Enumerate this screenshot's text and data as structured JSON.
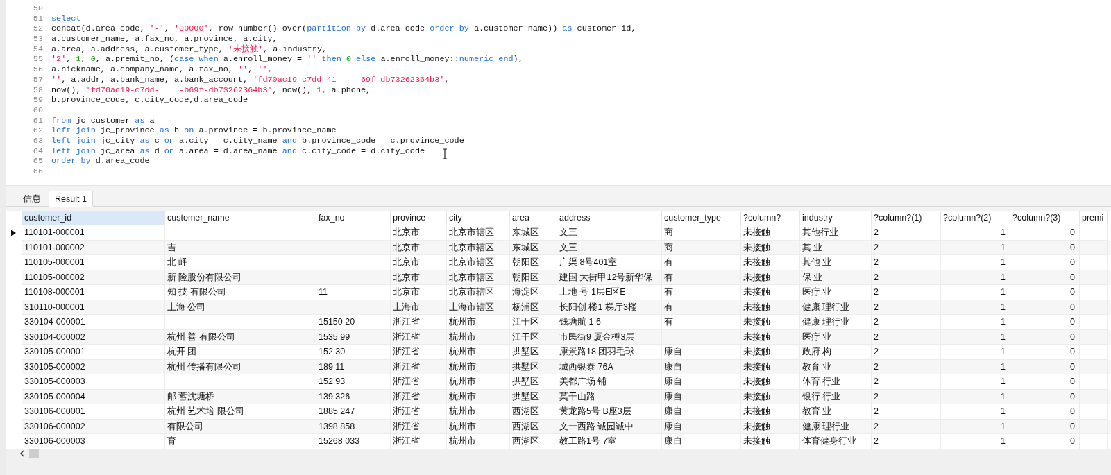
{
  "editor": {
    "lines": [
      {
        "number": "50"
      },
      {
        "number": "51",
        "tokens": [
          {
            "kind": "kw",
            "text": "select"
          }
        ]
      },
      {
        "number": "52",
        "tokens": [
          {
            "kind": "plain",
            "text": "concat(d.area_code, "
          },
          {
            "kind": "str",
            "text": "'-'"
          },
          {
            "kind": "plain",
            "text": ", "
          },
          {
            "kind": "str",
            "text": "'00000'"
          },
          {
            "kind": "plain",
            "text": ", row_number() over("
          },
          {
            "kind": "kw",
            "text": "partition by"
          },
          {
            "kind": "plain",
            "text": " d.area_code "
          },
          {
            "kind": "kw",
            "text": "order by"
          },
          {
            "kind": "plain",
            "text": " a.customer_name)) "
          },
          {
            "kind": "kw",
            "text": "as"
          },
          {
            "kind": "plain",
            "text": " customer_id,"
          }
        ]
      },
      {
        "number": "53",
        "tokens": [
          {
            "kind": "plain",
            "text": "a.customer_name, a.fax_no, a.province, a.city,"
          }
        ]
      },
      {
        "number": "54",
        "tokens": [
          {
            "kind": "plain",
            "text": "a.area, a.address, a.customer_type, "
          },
          {
            "kind": "str",
            "text": "'未接触'"
          },
          {
            "kind": "plain",
            "text": ", a.industry,"
          }
        ]
      },
      {
        "number": "55",
        "tokens": [
          {
            "kind": "str",
            "text": "'2'"
          },
          {
            "kind": "plain",
            "text": ", "
          },
          {
            "kind": "num",
            "text": "1"
          },
          {
            "kind": "plain",
            "text": ", "
          },
          {
            "kind": "num",
            "text": "0"
          },
          {
            "kind": "plain",
            "text": ", a.premit_no, ("
          },
          {
            "kind": "kw",
            "text": "case when"
          },
          {
            "kind": "plain",
            "text": " a.enroll_money = "
          },
          {
            "kind": "str",
            "text": "''"
          },
          {
            "kind": "kw",
            "text": " then "
          },
          {
            "kind": "num",
            "text": "0"
          },
          {
            "kind": "kw",
            "text": " else"
          },
          {
            "kind": "plain",
            "text": " a.enroll_money::"
          },
          {
            "kind": "kw",
            "text": "numeric end"
          },
          {
            "kind": "plain",
            "text": "),"
          }
        ]
      },
      {
        "number": "56",
        "tokens": [
          {
            "kind": "plain",
            "text": "a.nickname, a.company_name, a.tax_no, "
          },
          {
            "kind": "str",
            "text": "''"
          },
          {
            "kind": "plain",
            "text": ", "
          },
          {
            "kind": "str",
            "text": "''"
          },
          {
            "kind": "plain",
            "text": ","
          }
        ]
      },
      {
        "number": "57",
        "tokens": [
          {
            "kind": "str",
            "text": "''"
          },
          {
            "kind": "plain",
            "text": ", a.addr, a.bank_name, a.bank_account, "
          },
          {
            "kind": "str",
            "text": "'fd70ac19-c7dd-41     69f-db73262364b3'"
          },
          {
            "kind": "plain",
            "text": ","
          }
        ]
      },
      {
        "number": "58",
        "tokens": [
          {
            "kind": "plain",
            "text": "now(), "
          },
          {
            "kind": "str",
            "text": "'fd70ac19-c7dd-    -b69f-db73262364b3'"
          },
          {
            "kind": "plain",
            "text": ", now(), "
          },
          {
            "kind": "num",
            "text": "1"
          },
          {
            "kind": "plain",
            "text": ", a.phone,"
          }
        ]
      },
      {
        "number": "59",
        "tokens": [
          {
            "kind": "plain",
            "text": "b.province_code, c.city_code,d.area_code"
          }
        ]
      },
      {
        "number": "60"
      },
      {
        "number": "61",
        "tokens": [
          {
            "kind": "kw",
            "text": "from"
          },
          {
            "kind": "plain",
            "text": " jc_customer "
          },
          {
            "kind": "kw",
            "text": "as"
          },
          {
            "kind": "plain",
            "text": " a"
          }
        ]
      },
      {
        "number": "62",
        "tokens": [
          {
            "kind": "kw",
            "text": "left join"
          },
          {
            "kind": "plain",
            "text": " jc_province "
          },
          {
            "kind": "kw",
            "text": "as"
          },
          {
            "kind": "plain",
            "text": " b "
          },
          {
            "kind": "kw",
            "text": "on"
          },
          {
            "kind": "plain",
            "text": " a.province = b.province_name"
          }
        ]
      },
      {
        "number": "63",
        "tokens": [
          {
            "kind": "kw",
            "text": "left join"
          },
          {
            "kind": "plain",
            "text": " jc_city "
          },
          {
            "kind": "kw",
            "text": "as"
          },
          {
            "kind": "plain",
            "text": " c "
          },
          {
            "kind": "kw",
            "text": "on"
          },
          {
            "kind": "plain",
            "text": " a.city = c.city_name "
          },
          {
            "kind": "kw",
            "text": "and"
          },
          {
            "kind": "plain",
            "text": " b.province_code = c.province_code"
          }
        ]
      },
      {
        "number": "64",
        "tokens": [
          {
            "kind": "kw",
            "text": "left join"
          },
          {
            "kind": "plain",
            "text": " jc_area "
          },
          {
            "kind": "kw",
            "text": "as"
          },
          {
            "kind": "plain",
            "text": " d "
          },
          {
            "kind": "kw",
            "text": "on"
          },
          {
            "kind": "plain",
            "text": " a.area = d.area_name "
          },
          {
            "kind": "kw",
            "text": "and"
          },
          {
            "kind": "plain",
            "text": " c.city_code = d.city_code"
          }
        ]
      },
      {
        "number": "65",
        "tokens": [
          {
            "kind": "kw",
            "text": "order by"
          },
          {
            "kind": "plain",
            "text": " d.area_code"
          }
        ]
      },
      {
        "number": "66"
      }
    ]
  },
  "tabs": [
    {
      "label": "信息",
      "selected": false
    },
    {
      "label": "Result 1",
      "selected": true
    }
  ],
  "table": {
    "columns": [
      {
        "label": "customer_id",
        "selected": true
      },
      {
        "label": "customer_name",
        "selected": false
      },
      {
        "label": "fax_no",
        "selected": false
      },
      {
        "label": "province",
        "selected": false
      },
      {
        "label": "city",
        "selected": false
      },
      {
        "label": "area",
        "selected": false
      },
      {
        "label": "address",
        "selected": false
      },
      {
        "label": "customer_type",
        "selected": false
      },
      {
        "label": "?column?",
        "selected": false
      },
      {
        "label": "industry",
        "selected": false
      },
      {
        "label": "?column?(1)",
        "selected": false
      },
      {
        "label": "?column?(2)",
        "selected": false
      },
      {
        "label": "?column?(3)",
        "selected": false
      },
      {
        "label": "premi",
        "selected": false
      }
    ],
    "rows": [
      {
        "current": true,
        "cells": [
          "110101-000001",
          "",
          "",
          "北京市",
          "北京市辖区",
          "东城区",
          "文三",
          "商",
          "未接触",
          "其他行业",
          "2",
          "1",
          "0",
          ""
        ]
      },
      {
        "current": false,
        "cells": [
          "110101-000002",
          "吉",
          "",
          "北京市",
          "北京市辖区",
          "东城区",
          "文三",
          "商",
          "未接触",
          "其 业",
          "2",
          "1",
          "0",
          ""
        ]
      },
      {
        "current": false,
        "cells": [
          "110105-000001",
          "北 峄",
          "",
          "北京市",
          "北京市辖区",
          "朝阳区",
          "广渠 8号401室",
          "有",
          "未接触",
          "其他 业",
          "2",
          "1",
          "0",
          ""
        ]
      },
      {
        "current": false,
        "cells": [
          "110105-000002",
          "新 险股份有限公司",
          "",
          "北京市",
          "北京市辖区",
          "朝阳区",
          "建国 大街甲12号新华保",
          "有",
          "未接触",
          "保 业",
          "2",
          "1",
          "0",
          ""
        ]
      },
      {
        "current": false,
        "cells": [
          "110108-000001",
          "知 技 有限公司",
          "11",
          "北京市",
          "北京市辖区",
          "海淀区",
          "上地 号 1层E区E",
          "有",
          "未接触",
          "医疗 业",
          "2",
          "1",
          "0",
          ""
        ]
      },
      {
        "current": false,
        "cells": [
          "310110-000001",
          "上海 公司",
          "",
          "上海市",
          "上海市辖区",
          "杨浦区",
          "长阳创 楼1 梯厅3楼",
          "有",
          "未接触",
          "健康 理行业",
          "2",
          "1",
          "0",
          ""
        ]
      },
      {
        "current": false,
        "cells": [
          "330104-000001",
          "",
          "15150 20",
          "浙江省",
          "杭州市",
          "江干区",
          "钱塘航 1 6",
          "有",
          "未接触",
          "健康 理行业",
          "2",
          "1",
          "0",
          ""
        ]
      },
      {
        "current": false,
        "cells": [
          "330104-000002",
          "杭州 善 有限公司",
          "1535 99",
          "浙江省",
          "杭州市",
          "江干区",
          "市民街9 厦金樽3层",
          "",
          "未接触",
          "医疗 业",
          "2",
          "1",
          "0",
          ""
        ]
      },
      {
        "current": false,
        "cells": [
          "330105-000001",
          "杭开 团",
          "152 30",
          "浙江省",
          "杭州市",
          "拱墅区",
          "康景路18 团羽毛球",
          "康自",
          "未接触",
          "政府 构",
          "2",
          "1",
          "0",
          ""
        ]
      },
      {
        "current": false,
        "cells": [
          "330105-000002",
          "杭州 传播有限公司",
          "189 11",
          "浙江省",
          "杭州市",
          "拱墅区",
          "城西银泰 76A",
          "康自",
          "未接触",
          "教育 业",
          "2",
          "1",
          "0",
          ""
        ]
      },
      {
        "current": false,
        "cells": [
          "330105-000003",
          "",
          "152 93",
          "浙江省",
          "杭州市",
          "拱墅区",
          "美都广场 铺",
          "康自",
          "未接触",
          "体育 行业",
          "2",
          "1",
          "0",
          ""
        ]
      },
      {
        "current": false,
        "cells": [
          "330105-000004",
          "邮 蓄沈塘桥",
          "139 326",
          "浙江省",
          "杭州市",
          "拱墅区",
          "莫干山路",
          "康自",
          "未接触",
          "银行 行业",
          "2",
          "1",
          "0",
          ""
        ]
      },
      {
        "current": false,
        "cells": [
          "330106-000001",
          "杭州 艺术培 限公司",
          "1885 247",
          "浙江省",
          "杭州市",
          "西湖区",
          "黄龙路5号 B座3层",
          "康自",
          "未接触",
          "教育 业",
          "2",
          "1",
          "0",
          ""
        ]
      },
      {
        "current": false,
        "cells": [
          "330106-000002",
          "有限公司",
          "1398 858",
          "浙江省",
          "杭州市",
          "西湖区",
          "文一西路 诚园诚中",
          "康自",
          "未接触",
          "健康 理行业",
          "2",
          "1",
          "0",
          ""
        ]
      },
      {
        "current": false,
        "cells": [
          "330106-000003",
          "育",
          "15268 033",
          "浙江省",
          "杭州市",
          "西湖区",
          "教工路1号 7室",
          "康自",
          "未接触",
          "体育健身行业",
          "2",
          "1",
          "0",
          ""
        ]
      }
    ]
  }
}
